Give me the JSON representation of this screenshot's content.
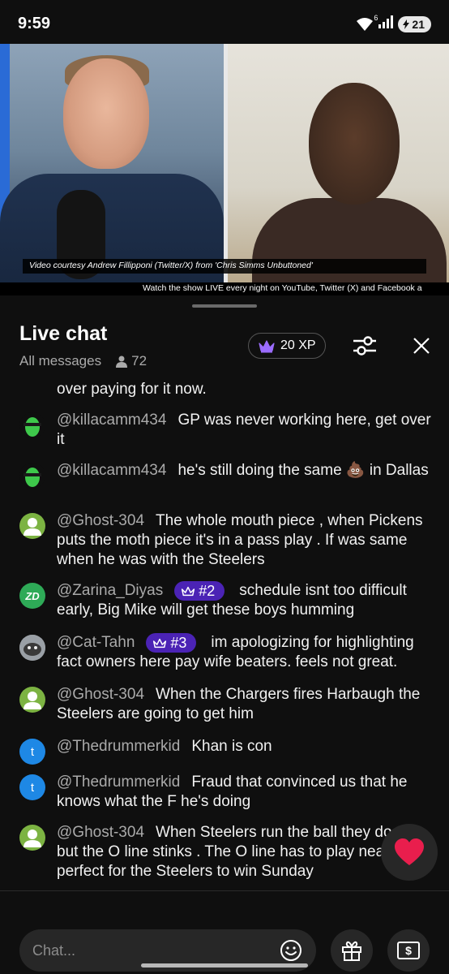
{
  "status_bar": {
    "time": "9:59",
    "network_type": "6",
    "battery_level": "21"
  },
  "video": {
    "caption": "Video courtesy Andrew Fillipponi (Twitter/X) from 'Chris Simms Unbuttoned'",
    "ticker": "Watch the show LIVE every night on YouTube, Twitter (X) and Facebook a"
  },
  "chat": {
    "title": "Live chat",
    "filter_label": "All messages",
    "viewer_count": "72",
    "xp_label": "20 XP",
    "messages": [
      {
        "author": "",
        "text": "over paying for it now.",
        "avatar": ""
      },
      {
        "author": "@killacamm434",
        "text": "GP was never working here, get over it",
        "avatar": ""
      },
      {
        "author": "@killacamm434",
        "text": "he's still doing the same 💩 in Dallas",
        "avatar": ""
      },
      {
        "author": "@Ghost-304",
        "text": "The whole mouth piece , when Pickens puts the moth piece it's in a pass play . If was same when he was with the Steelers",
        "avatar": ""
      },
      {
        "author": "@Zarina_Diyas",
        "badge": "#2",
        "text": "schedule isnt too difficult early, Big Mike will get these boys humming",
        "avatar": "ZD"
      },
      {
        "author": "@Cat-Tahn",
        "badge": "#3",
        "text": "im apologizing for highlighting fact owners here pay wife beaters. feels not great.",
        "avatar": ""
      },
      {
        "author": "@Ghost-304",
        "text": "When the Chargers fires Harbaugh the Steelers are going to get him",
        "avatar": ""
      },
      {
        "author": "@Thedrummerkid",
        "text": "Khan is con",
        "avatar": "t"
      },
      {
        "author": "@Thedrummerkid",
        "text": "Fraud that convinced us that he knows what the F he's doing",
        "avatar": "t"
      },
      {
        "author": "@Ghost-304",
        "text": "When Steelers run the ball they do win , but the O line stinks . The O line has to play near perfect for the Steelers to win Sunday",
        "avatar": ""
      }
    ],
    "input_placeholder": "Chat..."
  },
  "colors": {
    "badge": "#4b23b5",
    "ghost_avatar": "#7cb342",
    "drummer_avatar": "#1e88e5",
    "zd_avatar": "#2eaa57",
    "heart": "#e91e4d"
  },
  "icons": [
    "wifi-icon",
    "signal-icon",
    "battery-icon",
    "crown-icon",
    "person-icon",
    "sliders-icon",
    "close-icon",
    "heart-icon",
    "emoji-icon",
    "gift-icon",
    "money-icon"
  ]
}
